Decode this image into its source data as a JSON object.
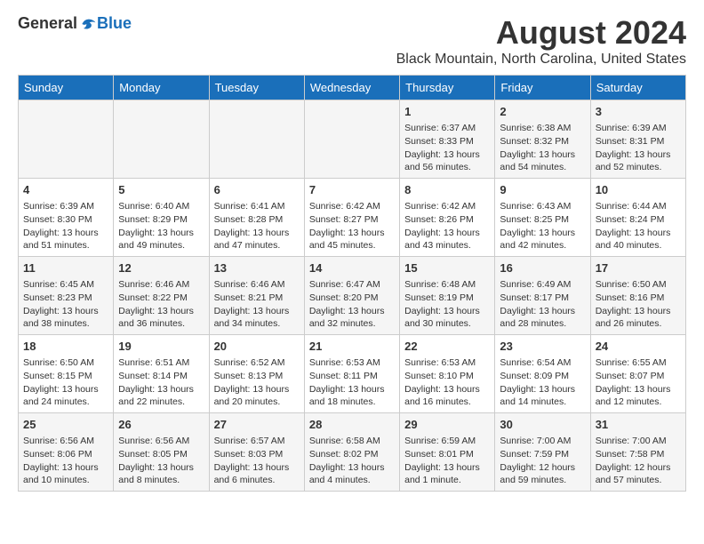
{
  "header": {
    "logo_general": "General",
    "logo_blue": "Blue",
    "main_title": "August 2024",
    "subtitle": "Black Mountain, North Carolina, United States"
  },
  "calendar": {
    "days_of_week": [
      "Sunday",
      "Monday",
      "Tuesday",
      "Wednesday",
      "Thursday",
      "Friday",
      "Saturday"
    ],
    "weeks": [
      [
        {
          "day": "",
          "info": ""
        },
        {
          "day": "",
          "info": ""
        },
        {
          "day": "",
          "info": ""
        },
        {
          "day": "",
          "info": ""
        },
        {
          "day": "1",
          "info": "Sunrise: 6:37 AM\nSunset: 8:33 PM\nDaylight: 13 hours\nand 56 minutes."
        },
        {
          "day": "2",
          "info": "Sunrise: 6:38 AM\nSunset: 8:32 PM\nDaylight: 13 hours\nand 54 minutes."
        },
        {
          "day": "3",
          "info": "Sunrise: 6:39 AM\nSunset: 8:31 PM\nDaylight: 13 hours\nand 52 minutes."
        }
      ],
      [
        {
          "day": "4",
          "info": "Sunrise: 6:39 AM\nSunset: 8:30 PM\nDaylight: 13 hours\nand 51 minutes."
        },
        {
          "day": "5",
          "info": "Sunrise: 6:40 AM\nSunset: 8:29 PM\nDaylight: 13 hours\nand 49 minutes."
        },
        {
          "day": "6",
          "info": "Sunrise: 6:41 AM\nSunset: 8:28 PM\nDaylight: 13 hours\nand 47 minutes."
        },
        {
          "day": "7",
          "info": "Sunrise: 6:42 AM\nSunset: 8:27 PM\nDaylight: 13 hours\nand 45 minutes."
        },
        {
          "day": "8",
          "info": "Sunrise: 6:42 AM\nSunset: 8:26 PM\nDaylight: 13 hours\nand 43 minutes."
        },
        {
          "day": "9",
          "info": "Sunrise: 6:43 AM\nSunset: 8:25 PM\nDaylight: 13 hours\nand 42 minutes."
        },
        {
          "day": "10",
          "info": "Sunrise: 6:44 AM\nSunset: 8:24 PM\nDaylight: 13 hours\nand 40 minutes."
        }
      ],
      [
        {
          "day": "11",
          "info": "Sunrise: 6:45 AM\nSunset: 8:23 PM\nDaylight: 13 hours\nand 38 minutes."
        },
        {
          "day": "12",
          "info": "Sunrise: 6:46 AM\nSunset: 8:22 PM\nDaylight: 13 hours\nand 36 minutes."
        },
        {
          "day": "13",
          "info": "Sunrise: 6:46 AM\nSunset: 8:21 PM\nDaylight: 13 hours\nand 34 minutes."
        },
        {
          "day": "14",
          "info": "Sunrise: 6:47 AM\nSunset: 8:20 PM\nDaylight: 13 hours\nand 32 minutes."
        },
        {
          "day": "15",
          "info": "Sunrise: 6:48 AM\nSunset: 8:19 PM\nDaylight: 13 hours\nand 30 minutes."
        },
        {
          "day": "16",
          "info": "Sunrise: 6:49 AM\nSunset: 8:17 PM\nDaylight: 13 hours\nand 28 minutes."
        },
        {
          "day": "17",
          "info": "Sunrise: 6:50 AM\nSunset: 8:16 PM\nDaylight: 13 hours\nand 26 minutes."
        }
      ],
      [
        {
          "day": "18",
          "info": "Sunrise: 6:50 AM\nSunset: 8:15 PM\nDaylight: 13 hours\nand 24 minutes."
        },
        {
          "day": "19",
          "info": "Sunrise: 6:51 AM\nSunset: 8:14 PM\nDaylight: 13 hours\nand 22 minutes."
        },
        {
          "day": "20",
          "info": "Sunrise: 6:52 AM\nSunset: 8:13 PM\nDaylight: 13 hours\nand 20 minutes."
        },
        {
          "day": "21",
          "info": "Sunrise: 6:53 AM\nSunset: 8:11 PM\nDaylight: 13 hours\nand 18 minutes."
        },
        {
          "day": "22",
          "info": "Sunrise: 6:53 AM\nSunset: 8:10 PM\nDaylight: 13 hours\nand 16 minutes."
        },
        {
          "day": "23",
          "info": "Sunrise: 6:54 AM\nSunset: 8:09 PM\nDaylight: 13 hours\nand 14 minutes."
        },
        {
          "day": "24",
          "info": "Sunrise: 6:55 AM\nSunset: 8:07 PM\nDaylight: 13 hours\nand 12 minutes."
        }
      ],
      [
        {
          "day": "25",
          "info": "Sunrise: 6:56 AM\nSunset: 8:06 PM\nDaylight: 13 hours\nand 10 minutes."
        },
        {
          "day": "26",
          "info": "Sunrise: 6:56 AM\nSunset: 8:05 PM\nDaylight: 13 hours\nand 8 minutes."
        },
        {
          "day": "27",
          "info": "Sunrise: 6:57 AM\nSunset: 8:03 PM\nDaylight: 13 hours\nand 6 minutes."
        },
        {
          "day": "28",
          "info": "Sunrise: 6:58 AM\nSunset: 8:02 PM\nDaylight: 13 hours\nand 4 minutes."
        },
        {
          "day": "29",
          "info": "Sunrise: 6:59 AM\nSunset: 8:01 PM\nDaylight: 13 hours\nand 1 minute."
        },
        {
          "day": "30",
          "info": "Sunrise: 7:00 AM\nSunset: 7:59 PM\nDaylight: 12 hours\nand 59 minutes."
        },
        {
          "day": "31",
          "info": "Sunrise: 7:00 AM\nSunset: 7:58 PM\nDaylight: 12 hours\nand 57 minutes."
        }
      ]
    ]
  }
}
